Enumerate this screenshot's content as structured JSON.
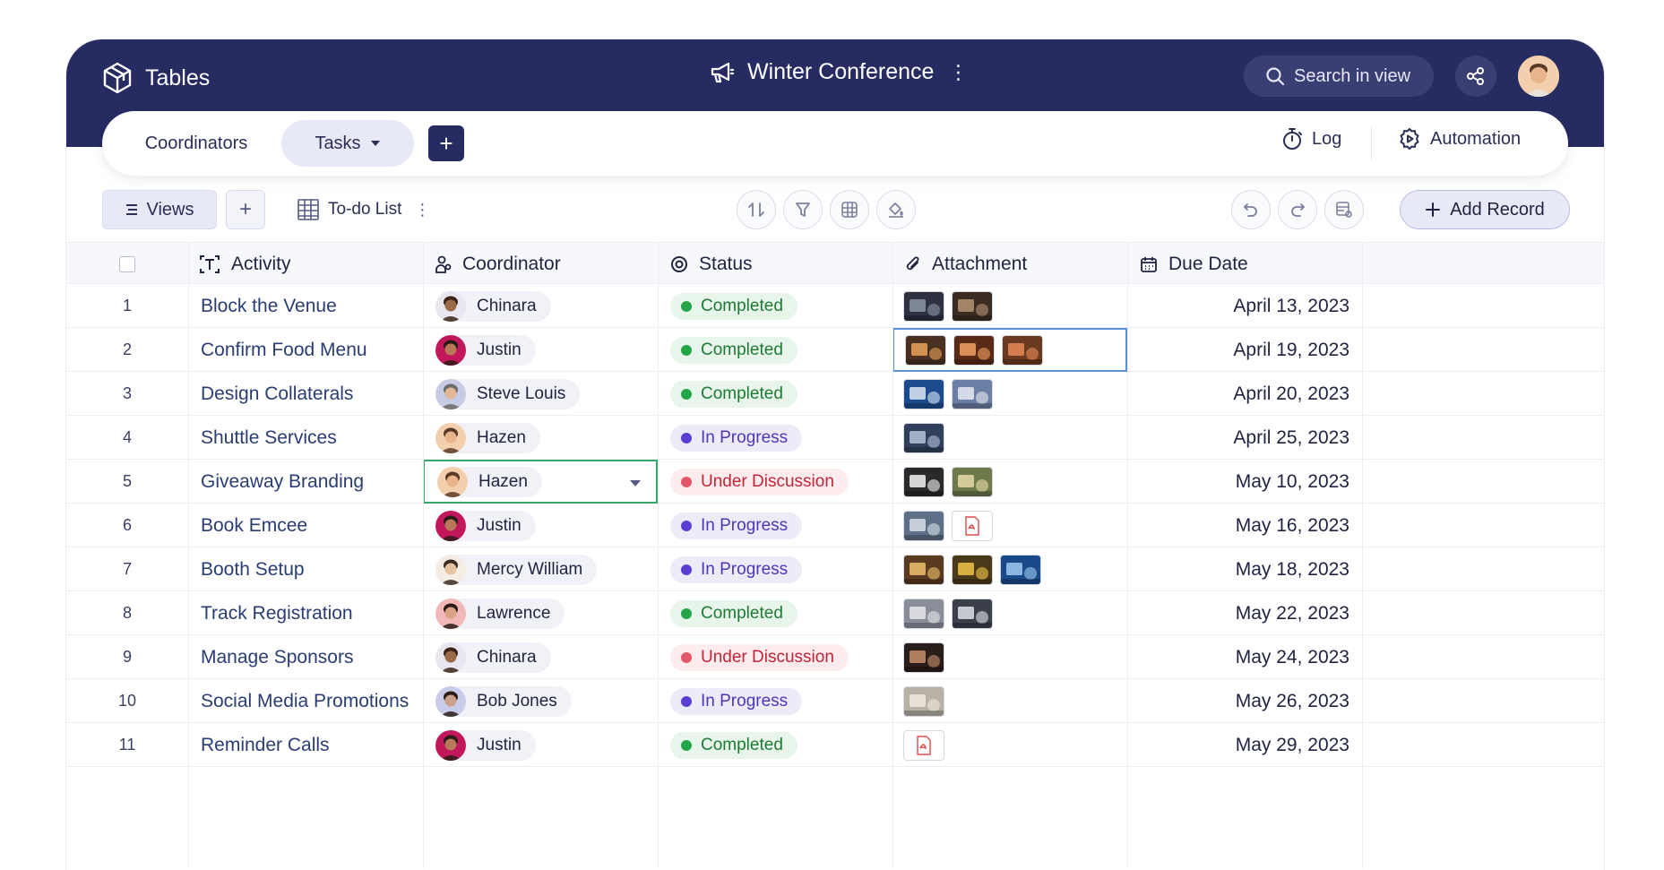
{
  "header": {
    "app_name": "Tables",
    "workspace_title": "Winter Conference",
    "search_label": "Search in view"
  },
  "tabs": {
    "coordinators": "Coordinators",
    "tasks": "Tasks",
    "add": "+",
    "log": "Log",
    "automation": "Automation"
  },
  "toolbar": {
    "views": "Views",
    "add_view": "+",
    "view_name": "To-do List",
    "add_record": "Add Record"
  },
  "columns": {
    "activity": "Activity",
    "coordinator": "Coordinator",
    "status": "Status",
    "attachment": "Attachment",
    "due_date": "Due Date"
  },
  "colors": {
    "header_bg": "#262b61",
    "completed": "#22a447",
    "in_progress": "#5b3fd2",
    "under_discussion": "#e2556a",
    "selected_cell": "#5b8fd8",
    "editing_cell": "#3aa66a"
  },
  "rows": [
    {
      "num": "1",
      "activity": "Block the Venue",
      "coordinator": "Chinara",
      "status": "Completed",
      "due": "April 13, 2023"
    },
    {
      "num": "2",
      "activity": "Confirm Food Menu",
      "coordinator": "Justin",
      "status": "Completed",
      "due": "April 19, 2023"
    },
    {
      "num": "3",
      "activity": "Design Collaterals",
      "coordinator": "Steve Louis",
      "status": "Completed",
      "due": "April 20, 2023"
    },
    {
      "num": "4",
      "activity": "Shuttle Services",
      "coordinator": "Hazen",
      "status": "In Progress",
      "due": "April 25, 2023"
    },
    {
      "num": "5",
      "activity": "Giveaway Branding",
      "coordinator": "Hazen",
      "status": "Under Discussion",
      "due": "May 10, 2023"
    },
    {
      "num": "6",
      "activity": "Book Emcee",
      "coordinator": "Justin",
      "status": "In Progress",
      "due": "May 16, 2023"
    },
    {
      "num": "7",
      "activity": "Booth Setup",
      "coordinator": "Mercy William",
      "status": "In Progress",
      "due": "May 18, 2023"
    },
    {
      "num": "8",
      "activity": "Track Registration",
      "coordinator": "Lawrence",
      "status": "Completed",
      "due": "May 22, 2023"
    },
    {
      "num": "9",
      "activity": "Manage Sponsors",
      "coordinator": "Chinara",
      "status": "Under Discussion",
      "due": "May 24, 2023"
    },
    {
      "num": "10",
      "activity": "Social Media Promotions",
      "coordinator": "Bob Jones",
      "status": "In Progress",
      "due": "May 26, 2023"
    },
    {
      "num": "11",
      "activity": "Reminder Calls",
      "coordinator": "Justin",
      "status": "Completed",
      "due": "May 29, 2023"
    }
  ]
}
